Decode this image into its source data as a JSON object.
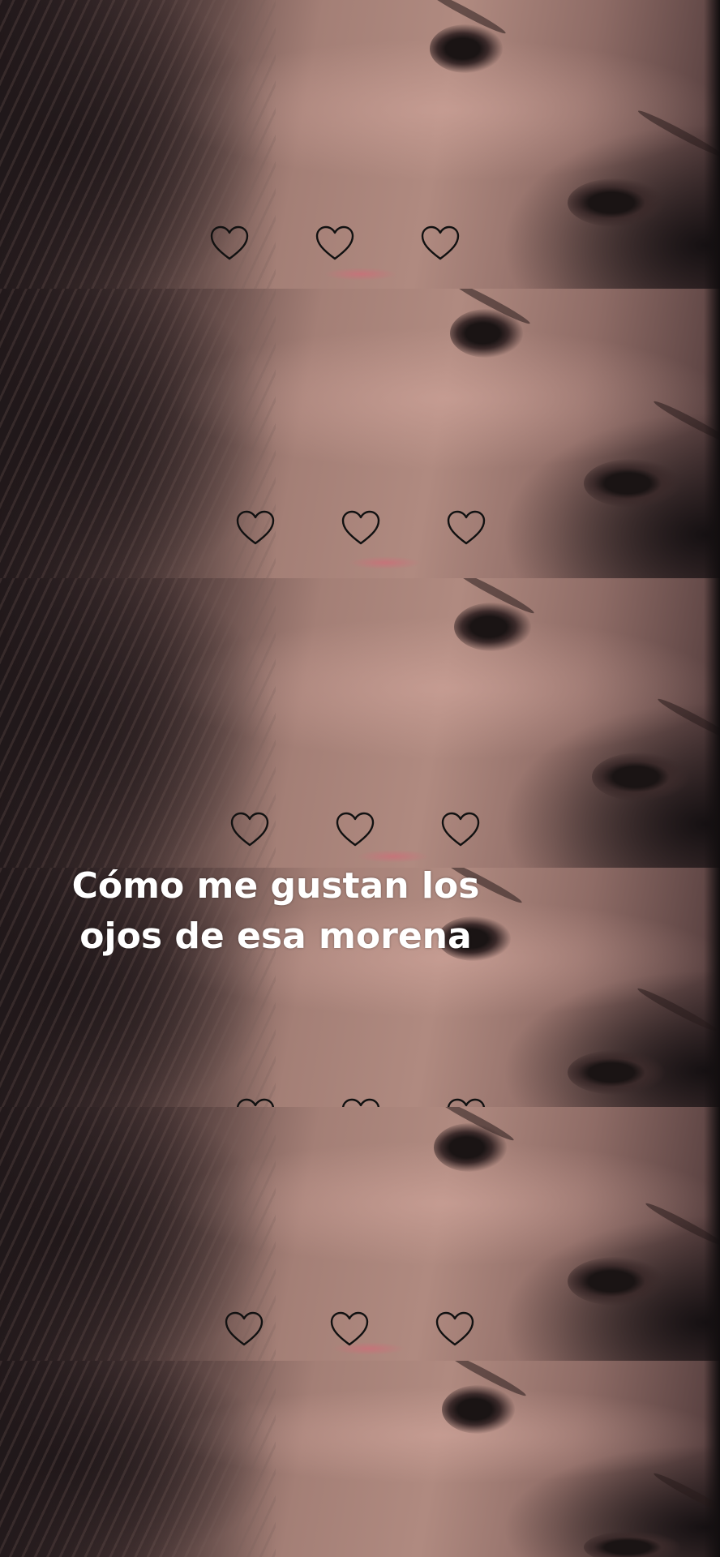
{
  "caption": {
    "line1": "Cómo me gustan los",
    "line2": "ojos de esa morena"
  },
  "strips": [
    {
      "hearts": [
        "heart-outline-icon",
        "heart-outline-icon",
        "heart-outline-icon"
      ]
    },
    {
      "hearts": [
        "heart-outline-icon",
        "heart-outline-icon",
        "heart-outline-icon"
      ]
    },
    {
      "hearts": [
        "heart-outline-icon",
        "heart-outline-icon",
        "heart-outline-icon"
      ]
    },
    {
      "hearts": [
        "heart-outline-icon",
        "heart-outline-icon",
        "heart-outline-icon"
      ]
    },
    {
      "hearts": [
        "heart-outline-icon",
        "heart-outline-icon",
        "heart-outline-icon"
      ]
    },
    {
      "hearts": []
    }
  ],
  "colors": {
    "caption_text": "#ffffff",
    "heart_stroke": "#111111",
    "divider": "#0b0909"
  }
}
